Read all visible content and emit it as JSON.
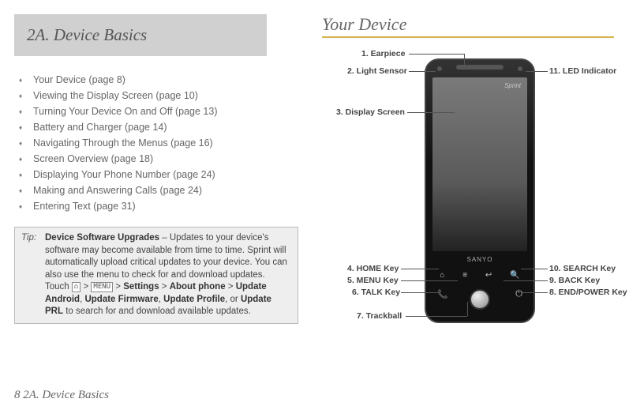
{
  "section": {
    "title": "2A.  Device Basics"
  },
  "toc": [
    "Your Device (page 8)",
    "Viewing the Display Screen (page 10)",
    "Turning Your Device On and Off (page 13)",
    "Battery and Charger (page 14)",
    "Navigating Through the Menus (page 16)",
    "Screen Overview (page 18)",
    "Displaying Your Phone Number (page 24)",
    "Making and Answering Calls (page 24)",
    "Entering Text (page 31)"
  ],
  "tip": {
    "label": "Tip:",
    "lead_bold": "Device Software Upgrades",
    "body_pre": " – Updates to your device's software may become available from time to time. Sprint will automatically upload critical updates to your device. You can also use the menu to check for and download updates. Touch ",
    "icon_home": "⌂",
    "sep1": " > ",
    "icon_menu": "MENU",
    "sep2": " > ",
    "bold_settings": "Settings",
    "sep3": " > ",
    "bold_about": "About phone",
    "sep4": " > ",
    "bold_update_android": "Update Android",
    "comma1": ", ",
    "bold_update_firmware": "Update Firmware",
    "comma2": ", ",
    "bold_update_profile": "Update Profile",
    "or": ", or ",
    "bold_update_prl": "Update PRL",
    "tail": " to search for and download available updates."
  },
  "right": {
    "title": "Your Device"
  },
  "diagram": {
    "screen_logo": "Sprint",
    "brand": "SANYO",
    "labels": {
      "l1": "1. Earpiece",
      "l2": "2. Light Sensor",
      "l3": "3. Display Screen",
      "l4": "4. HOME Key",
      "l5": "5. MENU Key",
      "l6": "6. TALK Key",
      "l7": "7. Trackball",
      "l8": "8. END/POWER Key",
      "l9": "9. BACK Key",
      "l10": "10. SEARCH Key",
      "l11": "11. LED Indicator"
    }
  },
  "footer": {
    "page_num": "8",
    "sep": "       ",
    "section_ref": "2A. Device Basics"
  }
}
